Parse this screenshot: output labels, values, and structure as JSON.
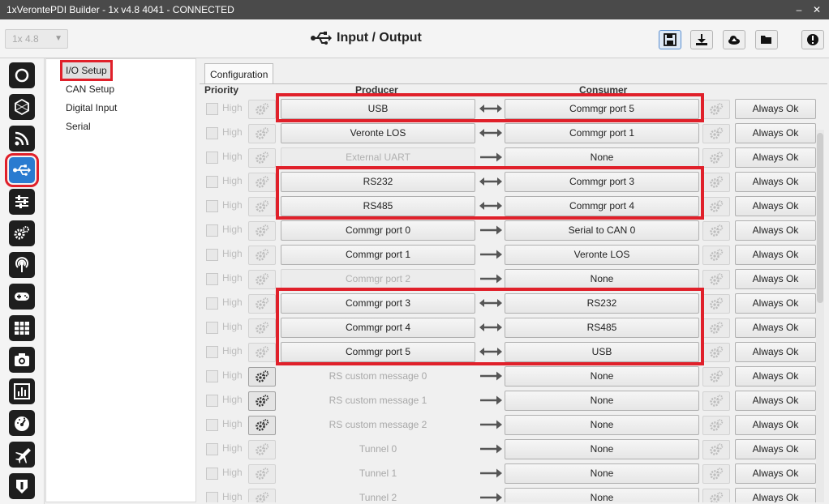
{
  "window": {
    "title": "1xVerontePDI Builder - 1x v4.8 4041 - CONNECTED",
    "minimize": "–",
    "close": "✕"
  },
  "header": {
    "version_select": "1x 4.8",
    "title": "Input / Output",
    "title_icon": "usb-icon",
    "buttons": [
      "save-icon",
      "download-icon",
      "cloud-upload-icon",
      "folder-open-icon",
      "alert-icon"
    ]
  },
  "sidebar": {
    "icons": [
      "power-icon",
      "hexagon-icon",
      "rss-icon",
      "usb-icon",
      "sliders-icon",
      "gears-icon",
      "broadcast-icon",
      "gamepad-icon",
      "grid-icon",
      "camera-icon",
      "chart-icon",
      "gauge-icon",
      "plane-icon",
      "shield-icon"
    ],
    "active_index": 3
  },
  "submenu": {
    "items": [
      "I/O Setup",
      "CAN Setup",
      "Digital Input",
      "Serial"
    ],
    "selected_index": 0
  },
  "content": {
    "tab": "Configuration",
    "columns": {
      "priority": "Priority",
      "producer": "Producer",
      "consumer": "Consumer"
    },
    "high_label": "High",
    "rows": [
      {
        "producer": "USB",
        "consumer": "Commgr port 5",
        "bidir": true,
        "producer_state": "active",
        "status": "Always Ok"
      },
      {
        "producer": "Veronte LOS",
        "consumer": "Commgr port 1",
        "bidir": true,
        "producer_state": "active",
        "status": "Always Ok"
      },
      {
        "producer": "External UART",
        "consumer": "None",
        "bidir": false,
        "producer_state": "disabled",
        "status": "Always Ok"
      },
      {
        "producer": "RS232",
        "consumer": "Commgr port 3",
        "bidir": true,
        "producer_state": "active",
        "status": "Always Ok"
      },
      {
        "producer": "RS485",
        "consumer": "Commgr port 4",
        "bidir": true,
        "producer_state": "active",
        "status": "Always Ok"
      },
      {
        "producer": "Commgr port 0",
        "consumer": "Serial to CAN 0",
        "bidir": false,
        "producer_state": "active",
        "status": "Always Ok"
      },
      {
        "producer": "Commgr port 1",
        "consumer": "Veronte LOS",
        "bidir": false,
        "producer_state": "active",
        "status": "Always Ok"
      },
      {
        "producer": "Commgr port 2",
        "consumer": "None",
        "bidir": false,
        "producer_state": "disabled",
        "status": "Always Ok"
      },
      {
        "producer": "Commgr port 3",
        "consumer": "RS232",
        "bidir": true,
        "producer_state": "active",
        "status": "Always Ok"
      },
      {
        "producer": "Commgr port 4",
        "consumer": "RS485",
        "bidir": true,
        "producer_state": "active",
        "status": "Always Ok"
      },
      {
        "producer": "Commgr port 5",
        "consumer": "USB",
        "bidir": true,
        "producer_state": "active",
        "status": "Always Ok"
      },
      {
        "producer": "RS custom message 0",
        "consumer": "None",
        "bidir": false,
        "producer_state": "ghost",
        "status": "Always Ok",
        "gear_on": true
      },
      {
        "producer": "RS custom message 1",
        "consumer": "None",
        "bidir": false,
        "producer_state": "ghost",
        "status": "Always Ok",
        "gear_on": true
      },
      {
        "producer": "RS custom message 2",
        "consumer": "None",
        "bidir": false,
        "producer_state": "ghost",
        "status": "Always Ok",
        "gear_on": true
      },
      {
        "producer": "Tunnel 0",
        "consumer": "None",
        "bidir": false,
        "producer_state": "ghost",
        "status": "Always Ok"
      },
      {
        "producer": "Tunnel 1",
        "consumer": "None",
        "bidir": false,
        "producer_state": "ghost",
        "status": "Always Ok"
      },
      {
        "producer": "Tunnel 2",
        "consumer": "None",
        "bidir": false,
        "producer_state": "ghost",
        "status": "Always Ok"
      }
    ]
  },
  "colors": {
    "accent": "#2a7bd0",
    "highlight": "#e0202a",
    "icon_dark": "#1e1e1e"
  }
}
